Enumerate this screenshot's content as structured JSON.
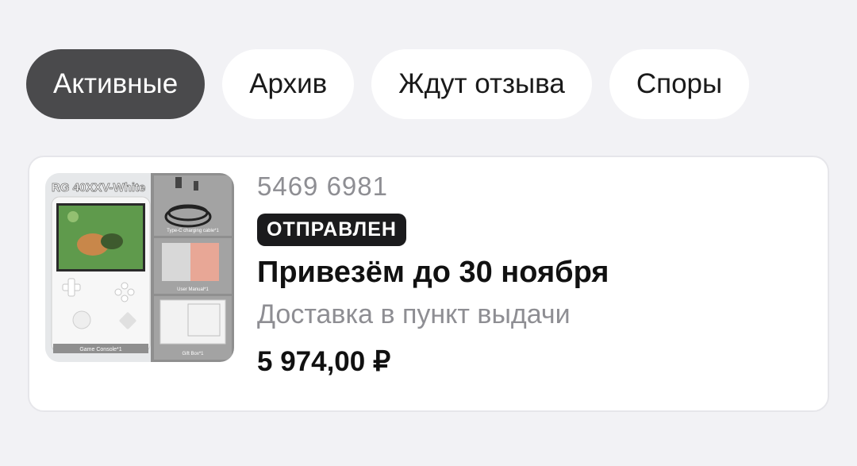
{
  "tabs": [
    {
      "label": "Активные",
      "active": true
    },
    {
      "label": "Архив",
      "active": false
    },
    {
      "label": "Ждут отзыва",
      "active": false
    },
    {
      "label": "Споры",
      "active": false
    }
  ],
  "order": {
    "number": "5469 6981",
    "status": "ОТПРАВЛЕН",
    "delivery_title": "Привезём до 30 ноября",
    "delivery_method": "Доставка в пункт выдачи",
    "price": "5 974,00 ₽",
    "image": {
      "title_text": "RG 40XXV-White",
      "captions": [
        "Type-C charging cable*1",
        "User Manual*1",
        "Game Console*1",
        "Gift Box*1"
      ]
    }
  },
  "colors": {
    "background": "#f2f2f5",
    "active_tab": "#4a4a4c",
    "badge": "#1b1b1d",
    "muted_text": "#8e8e93"
  }
}
